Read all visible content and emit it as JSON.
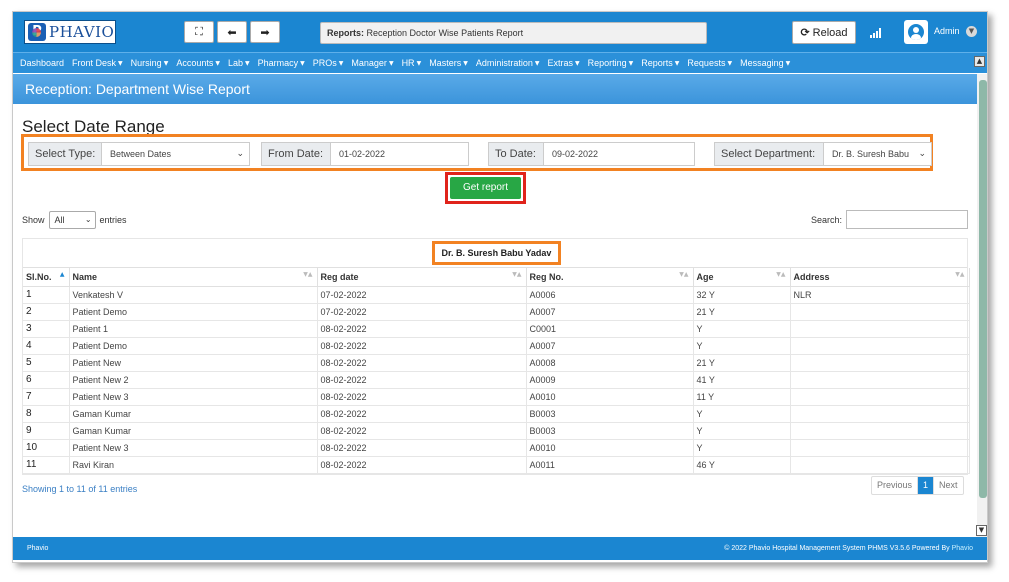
{
  "app": {
    "logo_text": "PHAVIO",
    "title_label": "Reports:",
    "title_value": "Reception Doctor Wise Patients Report",
    "reload_label": "Reload",
    "user_name": "Admin"
  },
  "toolbar": {
    "fullscreen_icon": "expand-icon",
    "back_icon": "arrow-left-icon",
    "forward_icon": "arrow-right-icon"
  },
  "nav": {
    "items": [
      {
        "label": "Dashboard",
        "has_caret": false
      },
      {
        "label": "Front Desk",
        "has_caret": true
      },
      {
        "label": "Nursing",
        "has_caret": true
      },
      {
        "label": "Accounts",
        "has_caret": true
      },
      {
        "label": "Lab",
        "has_caret": true
      },
      {
        "label": "Pharmacy",
        "has_caret": true
      },
      {
        "label": "PROs",
        "has_caret": true
      },
      {
        "label": "Manager",
        "has_caret": true
      },
      {
        "label": "HR",
        "has_caret": true
      },
      {
        "label": "Masters",
        "has_caret": true
      },
      {
        "label": "Administration",
        "has_caret": true
      },
      {
        "label": "Extras",
        "has_caret": true
      },
      {
        "label": "Reporting",
        "has_caret": true
      },
      {
        "label": "Reports",
        "has_caret": true
      },
      {
        "label": "Requests",
        "has_caret": true
      },
      {
        "label": "Messaging",
        "has_caret": true
      }
    ]
  },
  "page": {
    "header": "Reception: Department Wise Report",
    "section_title": "Select Date Range"
  },
  "filters": {
    "select_type_label": "Select Type:",
    "select_type_value": "Between Dates",
    "from_date_label": "From Date:",
    "from_date_value": "01-02-2022",
    "to_date_label": "To Date:",
    "to_date_value": "09-02-2022",
    "department_label": "Select Department:",
    "department_value": "Dr. B. Suresh Babu",
    "get_report_label": "Get report"
  },
  "table_controls": {
    "show_label": "Show",
    "show_value": "All",
    "entries_label": "entries",
    "search_label": "Search:"
  },
  "table": {
    "caption": "Dr. B. Suresh Babu Yadav",
    "columns": [
      "Sl.No.",
      "Name",
      "Reg date",
      "Reg No.",
      "Age",
      "Address"
    ],
    "rows": [
      [
        "1",
        "Venkatesh V",
        "07-02-2022",
        "A0006",
        "32 Y",
        "NLR"
      ],
      [
        "2",
        "Patient Demo",
        "07-02-2022",
        "A0007",
        "21 Y",
        ""
      ],
      [
        "3",
        "Patient 1",
        "08-02-2022",
        "C0001",
        "Y",
        ""
      ],
      [
        "4",
        "Patient Demo",
        "08-02-2022",
        "A0007",
        "Y",
        ""
      ],
      [
        "5",
        "Patient New",
        "08-02-2022",
        "A0008",
        "21 Y",
        ""
      ],
      [
        "6",
        "Patient New 2",
        "08-02-2022",
        "A0009",
        "41 Y",
        ""
      ],
      [
        "7",
        "Patient New 3",
        "08-02-2022",
        "A0010",
        "11 Y",
        ""
      ],
      [
        "8",
        "Gaman Kumar",
        "08-02-2022",
        "B0003",
        "Y",
        ""
      ],
      [
        "9",
        "Gaman Kumar",
        "08-02-2022",
        "B0003",
        "Y",
        ""
      ],
      [
        "10",
        "Patient New 3",
        "08-02-2022",
        "A0010",
        "Y",
        ""
      ],
      [
        "11",
        "Ravi Kiran",
        "08-02-2022",
        "A0011",
        "46 Y",
        ""
      ]
    ]
  },
  "pagination": {
    "showing_text": "Showing 1 to 11 of 11 entries",
    "previous_label": "Previous",
    "current_page": "1",
    "next_label": "Next"
  },
  "footer": {
    "left": "Phavio",
    "right_prefix": "© 2022 Phavio Hospital Management System PHMS V3.5.6 Powered By",
    "right_brand": "Phavio"
  },
  "colors": {
    "primary": "#1b86d1",
    "highlight_orange": "#f28222",
    "highlight_red": "#e0231b",
    "button_green": "#28a745"
  }
}
